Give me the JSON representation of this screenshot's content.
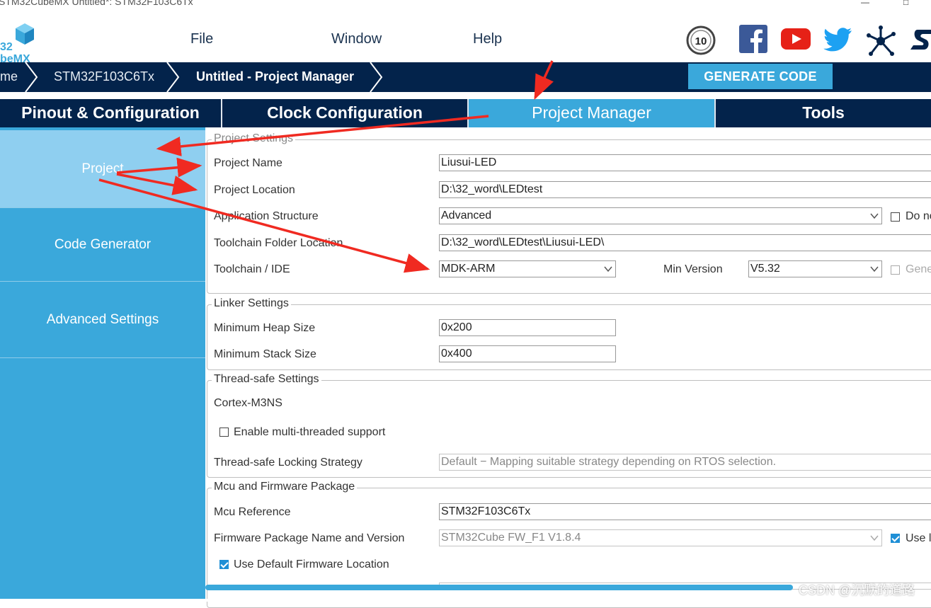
{
  "window": {
    "title": "STM32CubeMX Untitled*: STM32F103C6Tx"
  },
  "logo": {
    "line1": "32",
    "line2": "beMX"
  },
  "menu": {
    "file": "File",
    "window": "Window",
    "help": "Help"
  },
  "breadcrumb": {
    "home": "me",
    "mcu": "STM32F103C6Tx",
    "current": "Untitled - Project Manager"
  },
  "generate_button": "GENERATE CODE",
  "tabs": [
    "Pinout & Configuration",
    "Clock Configuration",
    "Project Manager",
    "Tools"
  ],
  "side_tabs": [
    "Project",
    "Code Generator",
    "Advanced Settings"
  ],
  "project_settings": {
    "legend": "Project Settings",
    "project_name_label": "Project Name",
    "project_name_value": "Liusui-LED",
    "project_location_label": "Project Location",
    "project_location_value": "D:\\32_word\\LEDtest",
    "app_structure_label": "Application Structure",
    "app_structure_value": "Advanced",
    "do_not_label": "Do no",
    "toolchain_folder_label": "Toolchain Folder Location",
    "toolchain_folder_value": "D:\\32_word\\LEDtest\\Liusui-LED\\",
    "toolchain_label": "Toolchain / IDE",
    "toolchain_value": "MDK-ARM",
    "min_version_label": "Min Version",
    "min_version_value": "V5.32",
    "generate_label": "Gene"
  },
  "linker_settings": {
    "legend": "Linker Settings",
    "heap_label": "Minimum Heap Size",
    "heap_value": "0x200",
    "stack_label": "Minimum Stack Size",
    "stack_value": "0x400"
  },
  "thread_settings": {
    "legend": "Thread-safe Settings",
    "core": "Cortex-M3NS",
    "multithread_label": "Enable multi-threaded support",
    "multithread_checked": false,
    "locking_label": "Thread-safe Locking Strategy",
    "locking_value": "Default  −  Mapping suitable strategy depending on RTOS selection."
  },
  "mcu_firmware": {
    "legend": "Mcu and Firmware Package",
    "mcu_ref_label": "Mcu Reference",
    "mcu_ref_value": "STM32F103C6Tx",
    "fw_label": "Firmware Package Name and Version",
    "fw_value": "STM32Cube FW_F1 V1.8.4",
    "use_latest_label": "Use l",
    "use_latest_checked": true,
    "default_loc_label": "Use Default Firmware Location",
    "default_loc_checked": true
  },
  "watermark": "CSDN @沉默的道路",
  "colors": {
    "navy": "#03234b",
    "accent": "#3aa8db",
    "side_active": "#8fcff0",
    "annotation_red": "#f02a21"
  }
}
